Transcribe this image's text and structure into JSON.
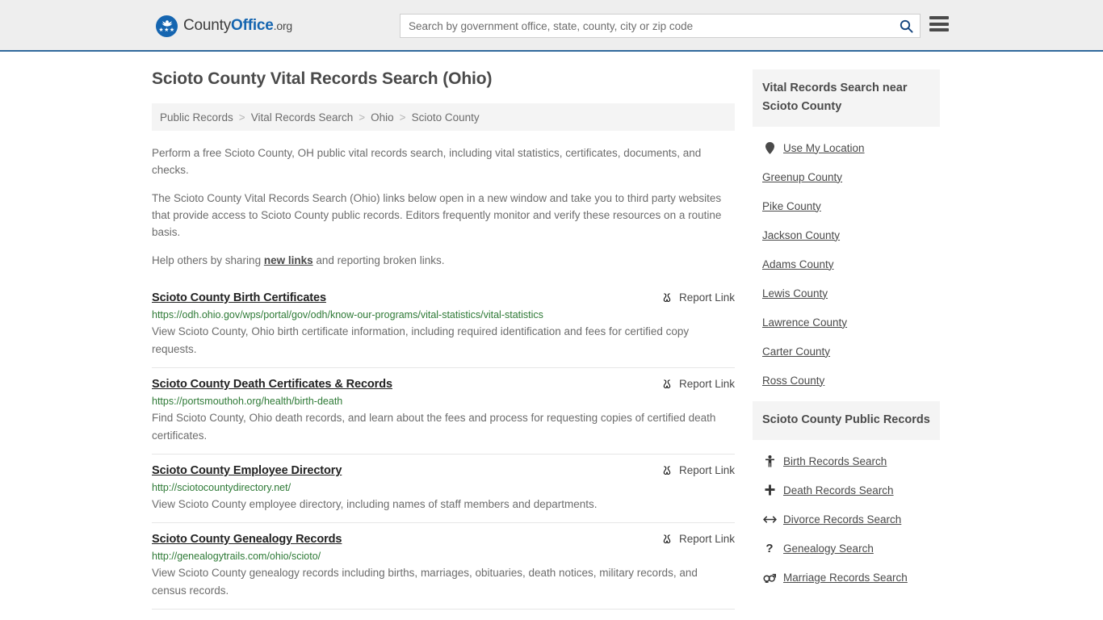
{
  "header": {
    "brand": {
      "part1": "County",
      "part2": "Office",
      "part3": ".org"
    },
    "search": {
      "placeholder": "Search by government office, state, county, city or zip code",
      "value": "",
      "search_icon": "search-icon"
    },
    "menu_icon": "hamburger-menu-icon",
    "accent_color": "#31699c"
  },
  "main": {
    "title": "Scioto County Vital Records Search (Ohio)",
    "breadcrumb": [
      {
        "label": "Public Records"
      },
      {
        "label": "Vital Records Search"
      },
      {
        "label": "Ohio"
      },
      {
        "label": "Scioto County"
      }
    ],
    "breadcrumb_separator": ">",
    "intro": {
      "p1": "Perform a free Scioto County, OH public vital records search, including vital statistics, certificates, documents, and checks.",
      "p2": "The Scioto County Vital Records Search (Ohio) links below open in a new window and take you to third party websites that provide access to Scioto County public records. Editors frequently monitor and verify these resources on a routine basis.",
      "p3_before": "Help others by sharing ",
      "p3_link": "new links",
      "p3_after": " and reporting broken links."
    },
    "report_link_label": "Report Link",
    "report_link_icon": "unlink-icon",
    "results": [
      {
        "title": "Scioto County Birth Certificates",
        "url": "https://odh.ohio.gov/wps/portal/gov/odh/know-our-programs/vital-statistics/vital-statistics",
        "description": "View Scioto County, Ohio birth certificate information, including required identification and fees for certified copy requests."
      },
      {
        "title": "Scioto County Death Certificates & Records",
        "url": "https://portsmouthoh.org/health/birth-death",
        "description": "Find Scioto County, Ohio death records, and learn about the fees and process for requesting copies of certified death certificates."
      },
      {
        "title": "Scioto County Employee Directory",
        "url": "http://sciotocountydirectory.net/",
        "description": "View Scioto County employee directory, including names of staff members and departments."
      },
      {
        "title": "Scioto County Genealogy Records",
        "url": "http://genealogytrails.com/ohio/scioto/",
        "description": "View Scioto County genealogy records including births, marriages, obituaries, death notices, military records, and census records."
      }
    ]
  },
  "sidebar": {
    "nearby": {
      "heading": "Vital Records Search near Scioto County",
      "items": [
        {
          "label": "Use My Location",
          "icon": "map-pin-icon"
        },
        {
          "label": "Greenup County",
          "icon": ""
        },
        {
          "label": "Pike County",
          "icon": ""
        },
        {
          "label": "Jackson County",
          "icon": ""
        },
        {
          "label": "Adams County",
          "icon": ""
        },
        {
          "label": "Lewis County",
          "icon": ""
        },
        {
          "label": "Lawrence County",
          "icon": ""
        },
        {
          "label": "Carter County",
          "icon": ""
        },
        {
          "label": "Ross County",
          "icon": ""
        }
      ]
    },
    "public_records": {
      "heading": "Scioto County Public Records",
      "items": [
        {
          "label": "Birth Records Search",
          "icon": "baby-icon",
          "glyph": "Ɣ"
        },
        {
          "label": "Death Records Search",
          "icon": "cross-icon",
          "glyph": "✚"
        },
        {
          "label": "Divorce Records Search",
          "icon": "arrows-horizontal-icon",
          "glyph": "↔"
        },
        {
          "label": "Genealogy Search",
          "icon": "question-mark-icon",
          "glyph": "?"
        },
        {
          "label": "Marriage Records Search",
          "icon": "gender-icon",
          "glyph": "⚥"
        }
      ]
    }
  }
}
